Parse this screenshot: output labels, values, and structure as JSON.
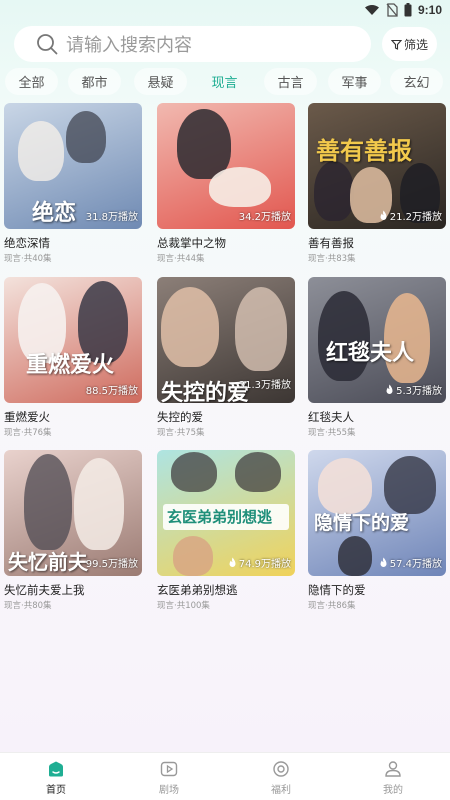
{
  "status_bar": {
    "time": "9:10"
  },
  "search": {
    "placeholder": "请输入搜索内容",
    "filter_label": "筛选"
  },
  "categories": [
    "全部",
    "都市",
    "悬疑",
    "现言",
    "古言",
    "军事",
    "玄幻"
  ],
  "active_category": "现言",
  "dramas": [
    {
      "title": "绝恋深情",
      "meta": "现言·共40集",
      "plays": "31.8万播放",
      "poster_text": "绝恋",
      "colors": [
        "#c9d6e6",
        "#6f8ab3"
      ]
    },
    {
      "title": "总裁掌中之物",
      "meta": "现言·共44集",
      "plays": "34.2万播放",
      "poster_text": "",
      "colors": [
        "#f1b9b0",
        "#e2574f"
      ]
    },
    {
      "title": "善有善报",
      "meta": "现言·共83集",
      "plays": "21.2万播放",
      "poster_text": "善有善报",
      "colors": [
        "#6b5a4a",
        "#2a2622"
      ]
    },
    {
      "title": "重燃爱火",
      "meta": "现言·共76集",
      "plays": "88.5万播放",
      "poster_text": "重燃爱火",
      "colors": [
        "#f3e2dc",
        "#cf6b5e"
      ]
    },
    {
      "title": "失控的爱",
      "meta": "现言·共75集",
      "plays": "31.3万播放",
      "poster_text": "失控的爱",
      "colors": [
        "#8c7f78",
        "#3c3633"
      ]
    },
    {
      "title": "红毯夫人",
      "meta": "现言·共55集",
      "plays": "5.3万播放",
      "poster_text": "红毯夫人",
      "colors": [
        "#8d8f98",
        "#4b4c57"
      ]
    },
    {
      "title": "失忆前夫爱上我",
      "meta": "现言·共80集",
      "plays": "99.5万播放",
      "poster_text": "失忆前夫",
      "colors": [
        "#e9d2cd",
        "#9b7b73"
      ]
    },
    {
      "title": "玄医弟弟别想逃",
      "meta": "现言·共100集",
      "plays": "74.9万播放",
      "poster_text": "玄医弟弟别想逃",
      "colors": [
        "#aee4e2",
        "#f0d25a"
      ]
    },
    {
      "title": "隐情下的爱",
      "meta": "现言·共86集",
      "plays": "57.4万播放",
      "poster_text": "隐情下的爱",
      "colors": [
        "#cfd8ec",
        "#6f85b8"
      ]
    }
  ],
  "bottom_nav": [
    {
      "label": "首页",
      "icon": "home-icon",
      "active": true
    },
    {
      "label": "剧场",
      "icon": "theater-icon",
      "active": false
    },
    {
      "label": "福利",
      "icon": "welfare-icon",
      "active": false
    },
    {
      "label": "我的",
      "icon": "profile-icon",
      "active": false
    }
  ],
  "accent_color": "#1fae93"
}
